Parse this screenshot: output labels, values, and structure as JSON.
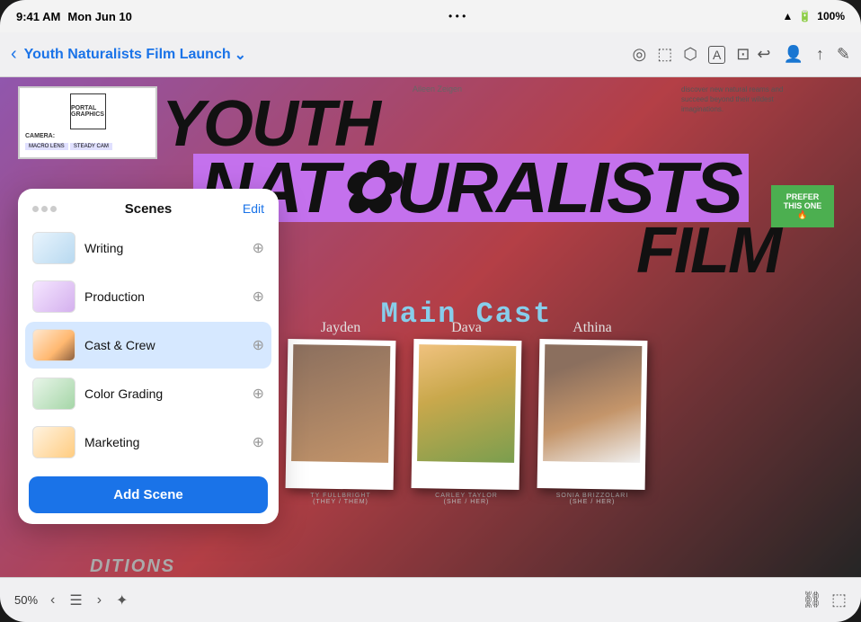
{
  "status_bar": {
    "time": "9:41 AM",
    "date": "Mon Jun 10",
    "wifi": "WiFi",
    "battery": "100%"
  },
  "toolbar": {
    "back_label": "‹",
    "title": "Youth Naturalists Film Launch",
    "title_arrow": "⌄",
    "center_icons": [
      "◎",
      "⬚",
      "⬡",
      "A",
      "⬜"
    ],
    "right_icons": [
      "↩",
      "👤",
      "↑",
      "✎"
    ]
  },
  "canvas": {
    "name_tag": "Aileen Zeigen",
    "discover_text": "discover new natural reams and succeed beyond their wildest imaginations.",
    "film_title_line1": "YOUTH",
    "film_title_line2": "NATURALISTS",
    "film_title_line3": "FILM",
    "main_cast_title": "Main Cast",
    "sticky_note": "PREFER THIS ONE 🔥",
    "bottom_text": "DITIONS",
    "cast": [
      {
        "name": "JAYDEN",
        "label": "TY FULLBRIGHT\n(THEY / THEM)",
        "photo_class": "p1"
      },
      {
        "name": "DAVA",
        "label": "CARLEY TAYLOR\n(SHE / HER)",
        "photo_class": "p2"
      },
      {
        "name": "Athina",
        "label": "SONIA BRIZZOLARI\n(SHE / HER)",
        "photo_class": "p3"
      }
    ]
  },
  "scenes_panel": {
    "title": "Scenes",
    "edit_label": "Edit",
    "items": [
      {
        "name": "Writing",
        "thumb_class": "thumb-writing",
        "active": false
      },
      {
        "name": "Production",
        "thumb_class": "thumb-production",
        "active": false
      },
      {
        "name": "Cast & Crew",
        "thumb_class": "thumb-cast",
        "active": true
      },
      {
        "name": "Color Grading",
        "thumb_class": "thumb-color",
        "active": false
      },
      {
        "name": "Marketing",
        "thumb_class": "thumb-marketing",
        "active": false
      }
    ],
    "add_button_label": "Add Scene"
  },
  "bottom_bar": {
    "zoom": "50%",
    "nav_prev": "‹",
    "nav_list": "☰",
    "nav_next": "›",
    "nav_star": "✦"
  }
}
